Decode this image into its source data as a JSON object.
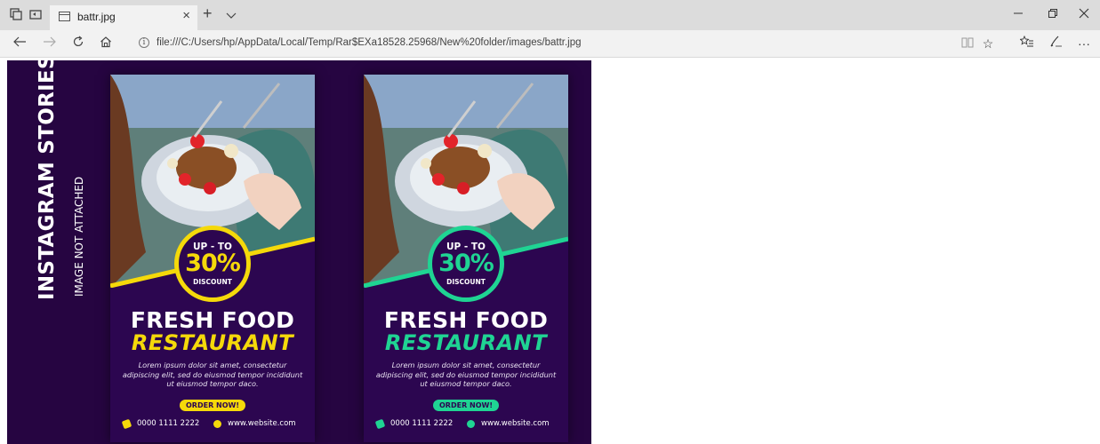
{
  "browser": {
    "tab": {
      "title": "battr.jpg"
    },
    "address": {
      "url": "file:///C:/Users/hp/AppData/Local/Temp/Rar$EXa18528.25968/New%20folder/images/battr.jpg"
    }
  },
  "image": {
    "side_title": "INSTAGRAM STORIES",
    "side_subtitle": "IMAGE NOT ATTACHED",
    "posters": [
      {
        "accent": "#f5d90a",
        "badge_top": "UP - TO",
        "badge_value": "30%",
        "badge_bottom": "DISCOUNT",
        "headline": "FRESH FOOD",
        "subheadline": "RESTAURANT",
        "body": "Lorem ipsum dolor sit amet, consectetur adipiscing elit, sed do eiusmod tempor incididunt ut eiusmod tempor daco.",
        "cta": "ORDER NOW!",
        "phone": "0000 1111 2222",
        "website": "www.website.com"
      },
      {
        "accent": "#1fd493",
        "badge_top": "UP - TO",
        "badge_value": "30%",
        "badge_bottom": "DISCOUNT",
        "headline": "FRESH FOOD",
        "subheadline": "RESTAURANT",
        "body": "Lorem ipsum dolor sit amet, consectetur adipiscing elit, sed do eiusmod tempor incididunt ut eiusmod tempor daco.",
        "cta": "ORDER NOW!",
        "phone": "0000 1111 2222",
        "website": "www.website.com"
      }
    ]
  },
  "colors": {
    "canvas_bg": "#260541",
    "poster_bg": "#2c0650",
    "yellow": "#f5d90a",
    "green": "#1fd493"
  }
}
